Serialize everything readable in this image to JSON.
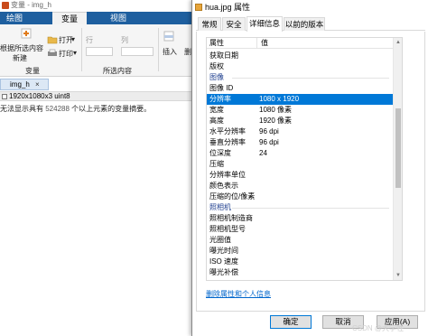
{
  "matlab": {
    "title": "变量 - img_h",
    "ribbon_tabs": [
      "绘图",
      "变量",
      "视图"
    ],
    "active_tab": "变量",
    "ribbon": {
      "new_from_selection": "根据所选内容",
      "new_label": "新建",
      "open_label": "打开",
      "print_label": "打印",
      "row_label": "行",
      "col_label": "列",
      "insert_label": "插入",
      "delete_label": "删",
      "group_variable": "变量",
      "group_selection": "所选内容"
    },
    "doc_tab": "img_h",
    "var_info": "1920x1080x3 uint8",
    "message_prefix": "无法显示具有",
    "message_number": "524288",
    "message_suffix": "个以上元素的变量摘要。"
  },
  "dialog": {
    "title": "hua.jpg 属性",
    "tabs": [
      "常规",
      "安全",
      "详细信息",
      "以前的版本"
    ],
    "active_tab": "详细信息",
    "header": {
      "property": "属性",
      "value": "值"
    },
    "rows": [
      {
        "key": "获取日期",
        "value": ""
      },
      {
        "key": "版权",
        "value": ""
      },
      {
        "key": "图像",
        "value": "",
        "section": true
      },
      {
        "key": "图像 ID",
        "value": ""
      },
      {
        "key": "分辨率",
        "value": "1080 x 1920",
        "selected": true
      },
      {
        "key": "宽度",
        "value": "1080 像素"
      },
      {
        "key": "高度",
        "value": "1920 像素"
      },
      {
        "key": "水平分辨率",
        "value": "96 dpi"
      },
      {
        "key": "垂直分辨率",
        "value": "96 dpi"
      },
      {
        "key": "位深度",
        "value": "24"
      },
      {
        "key": "压缩",
        "value": ""
      },
      {
        "key": "分辨率单位",
        "value": ""
      },
      {
        "key": "颜色表示",
        "value": ""
      },
      {
        "key": "压缩的位/像素",
        "value": ""
      },
      {
        "key": "照相机",
        "value": "",
        "section": true
      },
      {
        "key": "照相机制造商",
        "value": ""
      },
      {
        "key": "照相机型号",
        "value": ""
      },
      {
        "key": "光圈值",
        "value": ""
      },
      {
        "key": "曝光时间",
        "value": ""
      },
      {
        "key": "ISO 速度",
        "value": ""
      },
      {
        "key": "曝光补偿",
        "value": ""
      }
    ],
    "remove_link": "删除属性和个人信息",
    "buttons": {
      "ok": "确定",
      "cancel": "取消",
      "apply": "应用(A)"
    }
  },
  "watermark": "CSDN @大学牲"
}
